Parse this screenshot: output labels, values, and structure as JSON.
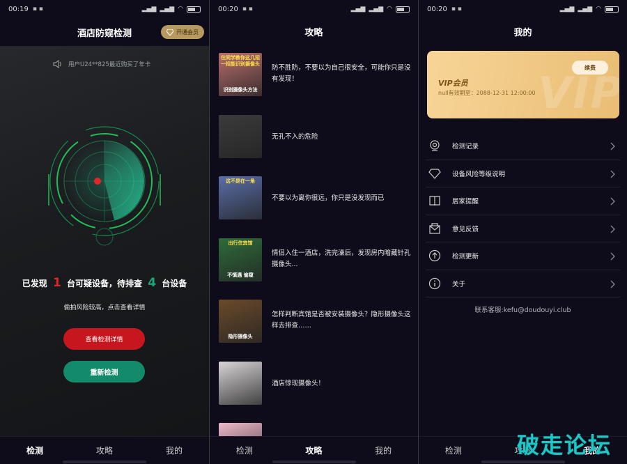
{
  "panel_detect": {
    "status": {
      "time": "00:19"
    },
    "title": "酒店防窥检测",
    "vip_button": "开通会员",
    "notice": "用户U24**825最近购买了年卡",
    "found": {
      "prefix": "已发现",
      "suspicious_count": "1",
      "middle": "台可疑设备，待排查",
      "pending_count": "4",
      "suffix": "台设备"
    },
    "risk_text": "偷拍风险较高，点击查看详情",
    "view_details_button": "查看检测详情",
    "recheck_button": "重新检测"
  },
  "panel_guides": {
    "status": {
      "time": "00:20"
    },
    "title": "攻略",
    "articles": [
      {
        "title": "防不胜防，不要以为自己很安全，可能你只是没有发现！",
        "thumb_top": "住同学教你这几招一招能识别摄像头",
        "thumb_bottom": "识别摄像头方法",
        "thumb_color": "#b96d6d"
      },
      {
        "title": "无孔不入的危险",
        "thumb_top": "",
        "thumb_bottom": "",
        "thumb_color": "#3b3b3b"
      },
      {
        "title": "不要以为离你很远，你只是没发现而已",
        "thumb_top": "这不是在一角",
        "thumb_bottom": "",
        "thumb_color": "#5a6ea8"
      },
      {
        "title": "情侣入住一酒店，洗完澡后，发现房内暗藏针孔摄像头...",
        "thumb_top": "出行住宾馆",
        "thumb_bottom": "不慎遇 偷窥",
        "thumb_color": "#2e6b3a"
      },
      {
        "title": "怎样判断宾馆是否被安装摄像头？隐形摄像头这样去排查……",
        "thumb_top": "",
        "thumb_bottom": "隐形摄像头",
        "thumb_color": "#6b4a2a"
      },
      {
        "title": "酒店惊现摄像头！",
        "thumb_top": "",
        "thumb_bottom": "",
        "thumb_color": "#d9d5d6"
      },
      {
        "title": "",
        "thumb_top": "",
        "thumb_bottom": "",
        "thumb_color": "#f0b8c8"
      }
    ]
  },
  "panel_mine": {
    "status": {
      "time": "00:20"
    },
    "title": "我的",
    "vip_card": {
      "title": "VIP会员",
      "expiry": "null有效期至：2088-12-31 12:00:00",
      "renew": "续费",
      "watermark": "VIP"
    },
    "menu": [
      {
        "label": "检测记录",
        "icon": "webcam-icon"
      },
      {
        "label": "设备风险等级说明",
        "icon": "diamond-icon"
      },
      {
        "label": "居家提醒",
        "icon": "book-icon"
      },
      {
        "label": "意见反馈",
        "icon": "mail-icon"
      },
      {
        "label": "检测更新",
        "icon": "upload-icon"
      },
      {
        "label": "关于",
        "icon": "info-icon"
      }
    ],
    "contact": "联系客服:kefu@doudouyi.club"
  },
  "tabbar": {
    "detect": "检测",
    "guides": "攻略",
    "mine": "我的"
  },
  "watermark_text": "破走论坛"
}
